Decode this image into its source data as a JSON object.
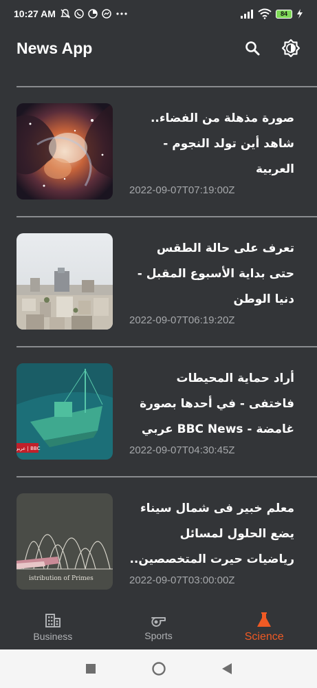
{
  "status_bar": {
    "time": "10:27 AM",
    "battery": "84",
    "icons_left": [
      "mute-icon",
      "whatsapp-icon",
      "data-saver-icon",
      "messenger-icon",
      "more-dots-icon"
    ],
    "icons_right": [
      "signal-icon",
      "wifi-icon",
      "battery-icon",
      "charging-icon"
    ]
  },
  "app_bar": {
    "title": "News App",
    "actions": [
      "search-icon",
      "theme-toggle-icon"
    ]
  },
  "articles": [
    {
      "title": "صورة مذهلة من الفضاء.. شاهد أين تولد النجوم - العربية",
      "date": "2022-09-07T07:19:00Z"
    },
    {
      "title": "تعرف على حالة الطقس حتى بداية الأسبوع المقبل - دنيا الوطن",
      "date": "2022-09-07T06:19:20Z"
    },
    {
      "title": "أراد حماية المحيطات فاختفى - في أحدها بصورة غامضة - BBC News عربي ...",
      "date": "2022-09-07T04:30:45Z"
    },
    {
      "title": "معلم خبير فى شمال سيناء يضع الحلول لمسائل رياضيات حيرت المتخصصين.. صور -...",
      "date": "2022-09-07T03:00:00Z"
    }
  ],
  "thumb_labels": {
    "bbc_badge": "عربي | BBC",
    "chalkboard_text": "istribution of Primes"
  },
  "bottom_nav": {
    "items": [
      {
        "label": "Business",
        "icon": "building-icon",
        "active": false
      },
      {
        "label": "Sports",
        "icon": "whistle-icon",
        "active": false
      },
      {
        "label": "Science",
        "icon": "flask-icon",
        "active": true
      }
    ]
  },
  "colors": {
    "background": "#333538",
    "accent": "#f05a24",
    "date_text": "#a6a8ab",
    "divider": "#8a8c8f"
  }
}
